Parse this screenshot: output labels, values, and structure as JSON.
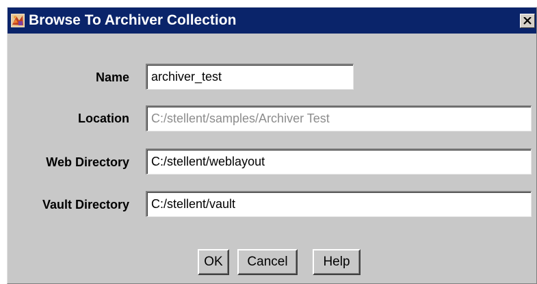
{
  "window": {
    "title": "Browse To Archiver Collection",
    "app_icon": "archiver-app-icon",
    "close_icon": "close-icon"
  },
  "form": {
    "name": {
      "label": "Name",
      "value": "archiver_test"
    },
    "location": {
      "label": "Location",
      "value": "C:/stellent/samples/Archiver Test",
      "enabled": false
    },
    "web_directory": {
      "label": "Web Directory",
      "value": "C:/stellent/weblayout"
    },
    "vault_directory": {
      "label": "Vault Directory",
      "value": "C:/stellent/vault"
    }
  },
  "buttons": {
    "ok": "OK",
    "cancel": "Cancel",
    "help": "Help"
  },
  "colors": {
    "titlebar": "#0a246a",
    "dialog_background": "#c8c8c8",
    "disabled_text": "#8c8c8c"
  }
}
